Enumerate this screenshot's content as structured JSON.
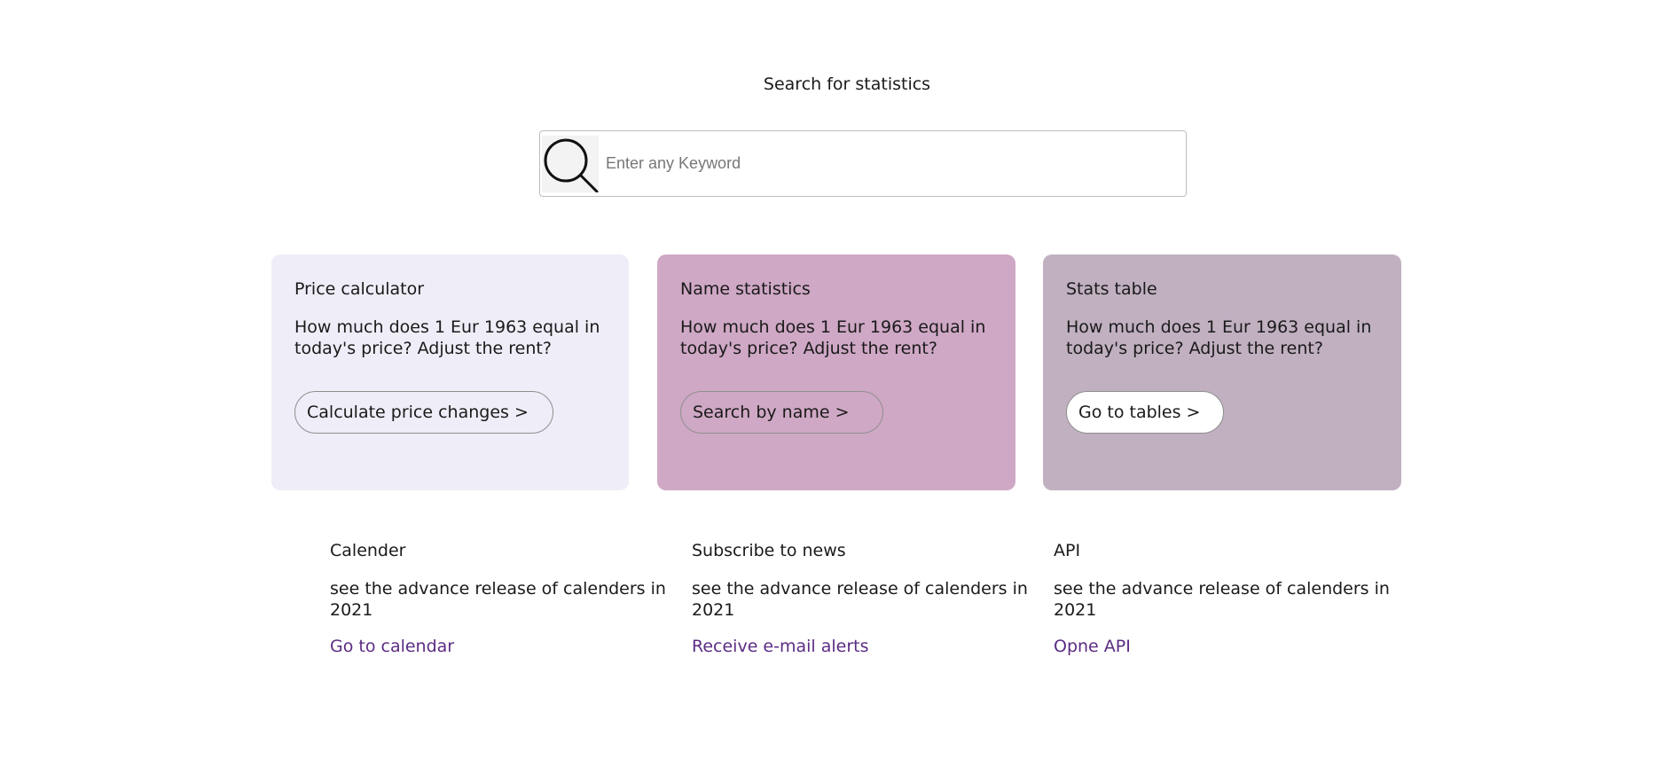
{
  "search": {
    "heading": "Search for statistics",
    "placeholder": "Enter any Keyword",
    "icon": "search-icon"
  },
  "colors": {
    "card1_bg": "#efedf7",
    "card2_bg": "#cfa8c5",
    "card3_bg": "#c0b0c0",
    "link": "#5b2c83"
  },
  "cards": [
    {
      "title": "Price calculator",
      "description": "How much does 1 Eur 1963 equal in today's price? Adjust the rent?",
      "button_label": "Calculate price changes >"
    },
    {
      "title": "Name statistics",
      "description": "How much does 1 Eur 1963 equal in today's price? Adjust the rent?",
      "button_label": "Search by name >"
    },
    {
      "title": "Stats table",
      "description": "How much does 1 Eur 1963 equal in today's price? Adjust the rent?",
      "button_label": "Go to tables >"
    }
  ],
  "info": [
    {
      "title": "Calender",
      "description": "see the advance release of calenders in 2021",
      "link_label": "Go to calendar"
    },
    {
      "title": "Subscribe to news",
      "description": "see the advance release of calenders in 2021",
      "link_label": "Receive e-mail alerts"
    },
    {
      "title": "API",
      "description": "see the advance release of calenders in 2021",
      "link_label": "Opne API"
    }
  ]
}
